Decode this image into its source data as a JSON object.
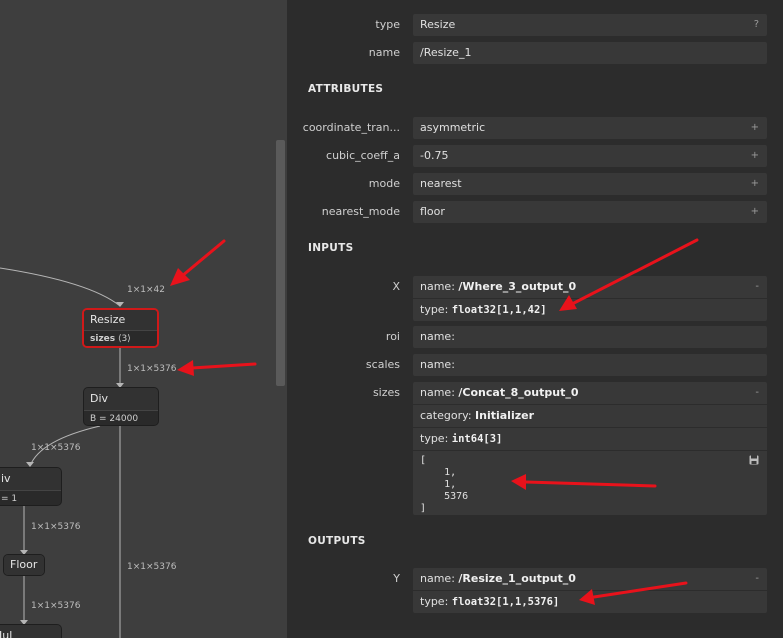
{
  "graph": {
    "shape_labels": {
      "resize_in": "1×1×42",
      "resize_out": "1×1×5376",
      "div_left": "1×1×5376",
      "div_floor": "1×1×5376",
      "floor_mul": "1×1×5376",
      "div_down": "1×1×5376"
    },
    "nodes": {
      "resize": {
        "title": "Resize",
        "attr_name": "sizes",
        "attr_value": "⟨3⟩"
      },
      "div_main": {
        "title": "Div",
        "attr": "B = 24000"
      },
      "div_left": {
        "title": "iv",
        "attr": "= 1"
      },
      "floor": {
        "title": "Floor"
      },
      "mul": {
        "title": "Iul"
      }
    }
  },
  "panel": {
    "type": {
      "label": "type",
      "value": "Resize",
      "help": "?"
    },
    "name": {
      "label": "name",
      "value": "/Resize_1"
    },
    "attributes": {
      "header": "ATTRIBUTES",
      "items": [
        {
          "label": "coordinate_tran...",
          "value": "asymmetric",
          "toggle": "+"
        },
        {
          "label": "cubic_coeff_a",
          "value": "-0.75",
          "toggle": "+"
        },
        {
          "label": "mode",
          "value": "nearest",
          "toggle": "+"
        },
        {
          "label": "nearest_mode",
          "value": "floor",
          "toggle": "+"
        }
      ]
    },
    "inputs": {
      "header": "INPUTS",
      "x": {
        "label": "X",
        "name_key": "name:",
        "name": "/Where_3_output_0",
        "type_key": "type:",
        "type": "float32[1,1,42]",
        "toggle": "-"
      },
      "roi": {
        "label": "roi",
        "name_key": "name:"
      },
      "scales": {
        "label": "scales",
        "name_key": "name:"
      },
      "sizes": {
        "label": "sizes",
        "name_key": "name:",
        "name": "/Concat_8_output_0",
        "category_key": "category:",
        "category": "Initializer",
        "type_key": "type:",
        "type": "int64[3]",
        "toggle": "-",
        "data": "[\n    1,\n    1,\n    5376\n]"
      }
    },
    "outputs": {
      "header": "OUTPUTS",
      "y": {
        "label": "Y",
        "name_key": "name:",
        "name": "/Resize_1_output_0",
        "type_key": "type:",
        "type": "float32[1,1,5376]",
        "toggle": "-"
      }
    }
  },
  "colors": {
    "selected_border": "#d01919",
    "annotation_arrow": "#e8121b",
    "panel_bg": "#2c2c2c",
    "graph_bg": "#3e3e3e"
  }
}
